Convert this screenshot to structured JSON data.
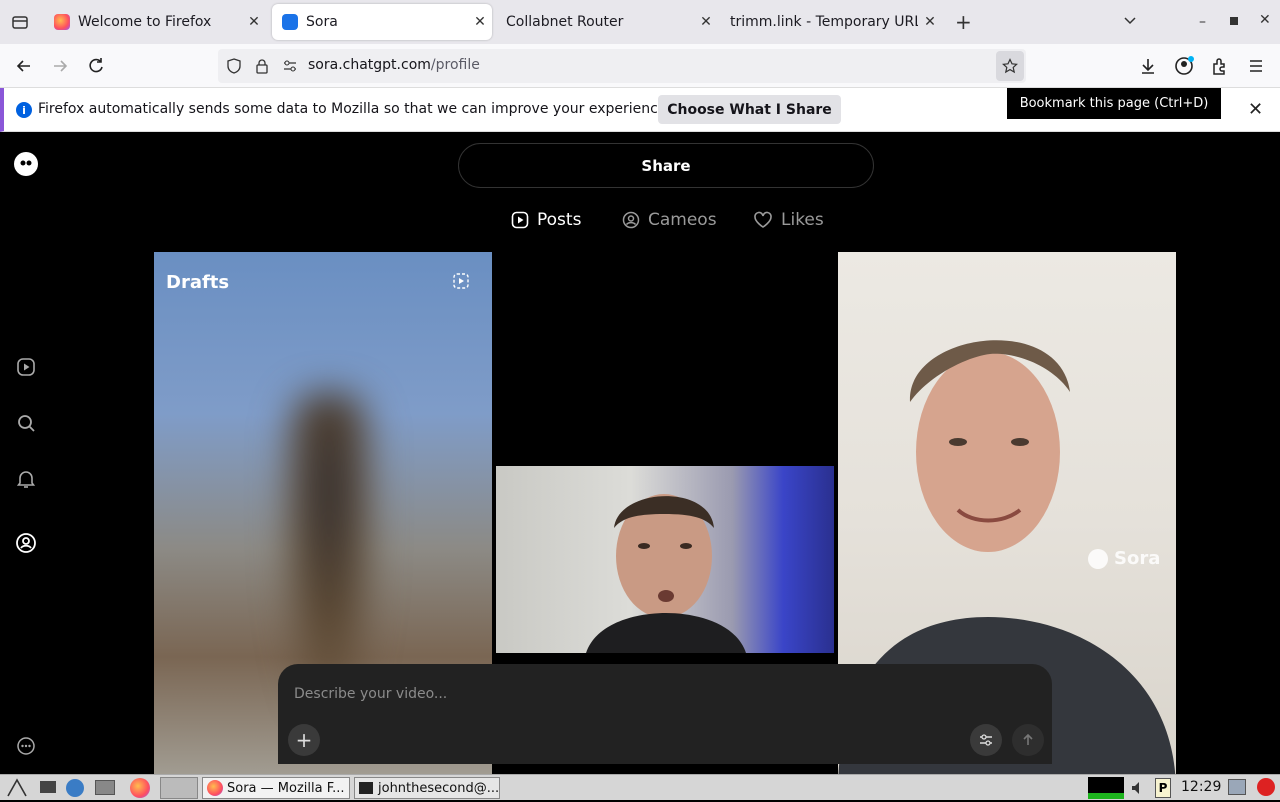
{
  "browser": {
    "tabs": [
      {
        "title": "Welcome to Firefox",
        "active": false
      },
      {
        "title": "Sora",
        "active": true
      },
      {
        "title": "Collabnet Router",
        "active": false
      },
      {
        "title": "trimm.link - Temporary URL",
        "active": false
      }
    ],
    "url_domain": "sora.chatgpt.com",
    "url_path": "/profile",
    "notification_text": "Firefox automatically sends some data to Mozilla so that we can improve your experience.",
    "notification_button": "Choose What I Share",
    "tooltip": "Bookmark this page (Ctrl+D)"
  },
  "app": {
    "share_label": "Share",
    "profile_tabs": [
      {
        "label": "Posts",
        "active": true
      },
      {
        "label": "Cameos",
        "active": false
      },
      {
        "label": "Likes",
        "active": false
      }
    ],
    "drafts_label": "Drafts",
    "watermark": "Sora",
    "composer_placeholder": "Describe your video..."
  },
  "taskbar": {
    "tasks": [
      "Sora — Mozilla F...",
      "johnthesecond@..."
    ],
    "clock": "12:29"
  },
  "colors": {
    "accent_notification": "#8a57d8",
    "info_icon": "#0061e0"
  }
}
